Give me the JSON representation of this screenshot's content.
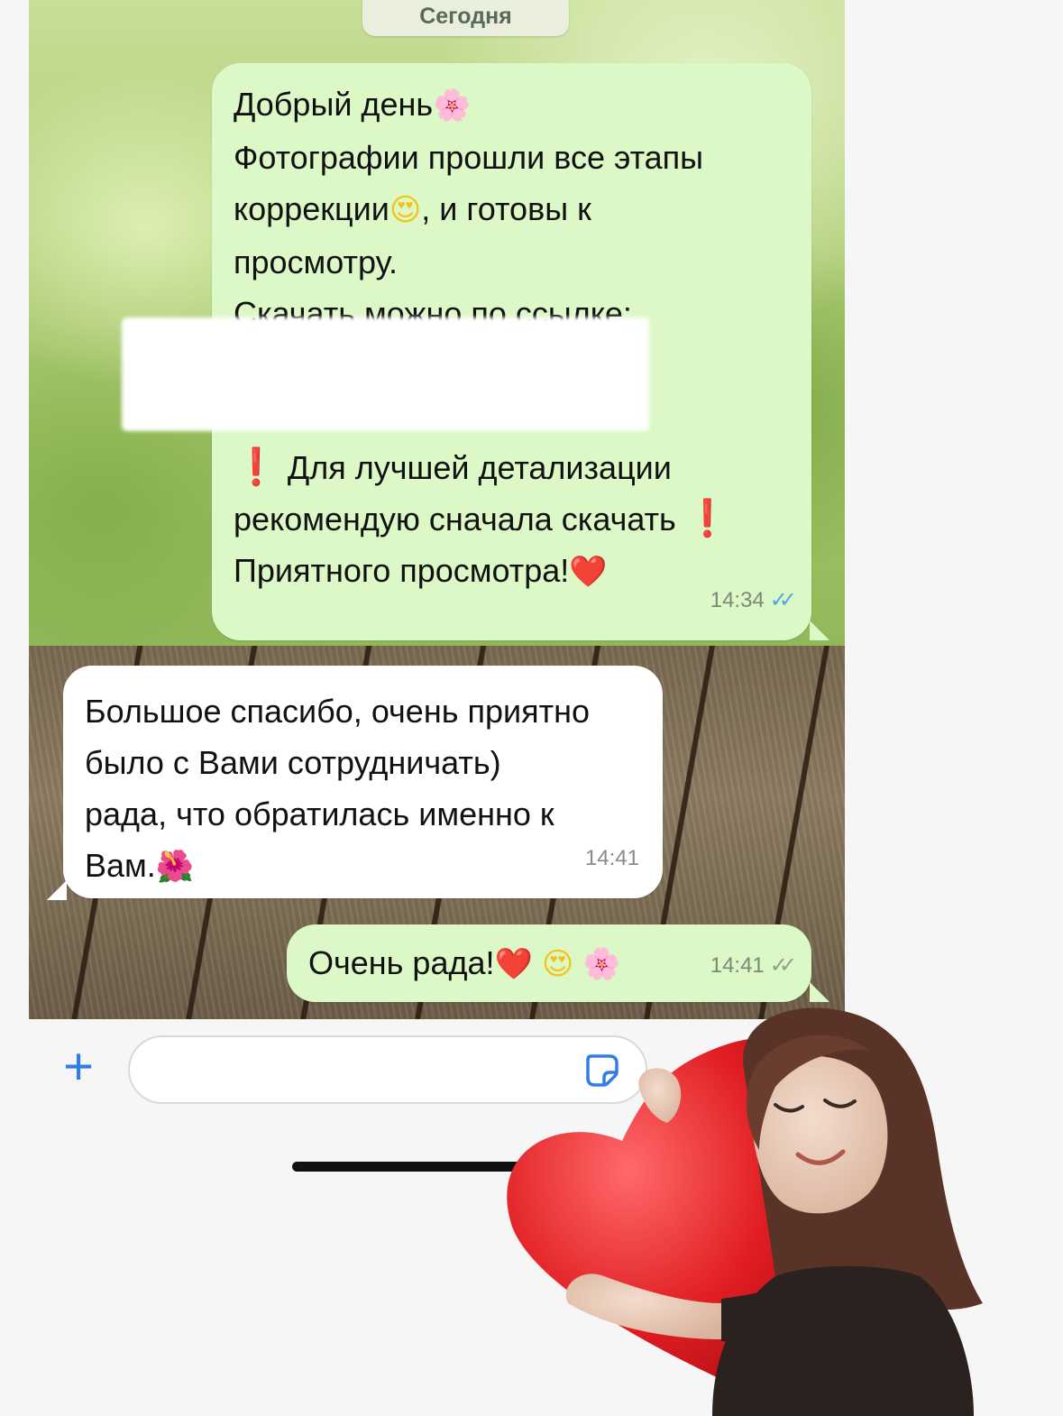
{
  "chat": {
    "date_label": "Сегодня",
    "messages": [
      {
        "direction": "outgoing",
        "lines": [
          "Добрый день",
          "Фотографии прошли все этапы",
          "коррекции",
          ", и готовы к",
          "просмотру.",
          "Скачать можно по ссылке:",
          "Для лучшей детализации",
          "рекомендую сначала скачать",
          "Приятного просмотра!"
        ],
        "time": "14:34",
        "read": true
      },
      {
        "direction": "incoming",
        "lines": [
          "Большое спасибо, очень приятно",
          "было с Вами сотрудничать)",
          "рада, что обратилась именно к",
          "Вам."
        ],
        "time": "14:41"
      },
      {
        "direction": "outgoing",
        "lines": [
          "Очень рада!"
        ],
        "time": "14:41",
        "read": false
      }
    ]
  },
  "emoji": {
    "flower": "🌸",
    "face": "😍",
    "bang": "❗",
    "heart": "❤️",
    "hibiscus": "🌺"
  },
  "icons": {
    "plus": "+",
    "ticks": "✓✓"
  },
  "colors": {
    "outgoing_bubble": "#dcf8c6",
    "incoming_bubble": "#ffffff",
    "read_ticks": "#49a9e8",
    "accent": "#2f7ee6"
  }
}
